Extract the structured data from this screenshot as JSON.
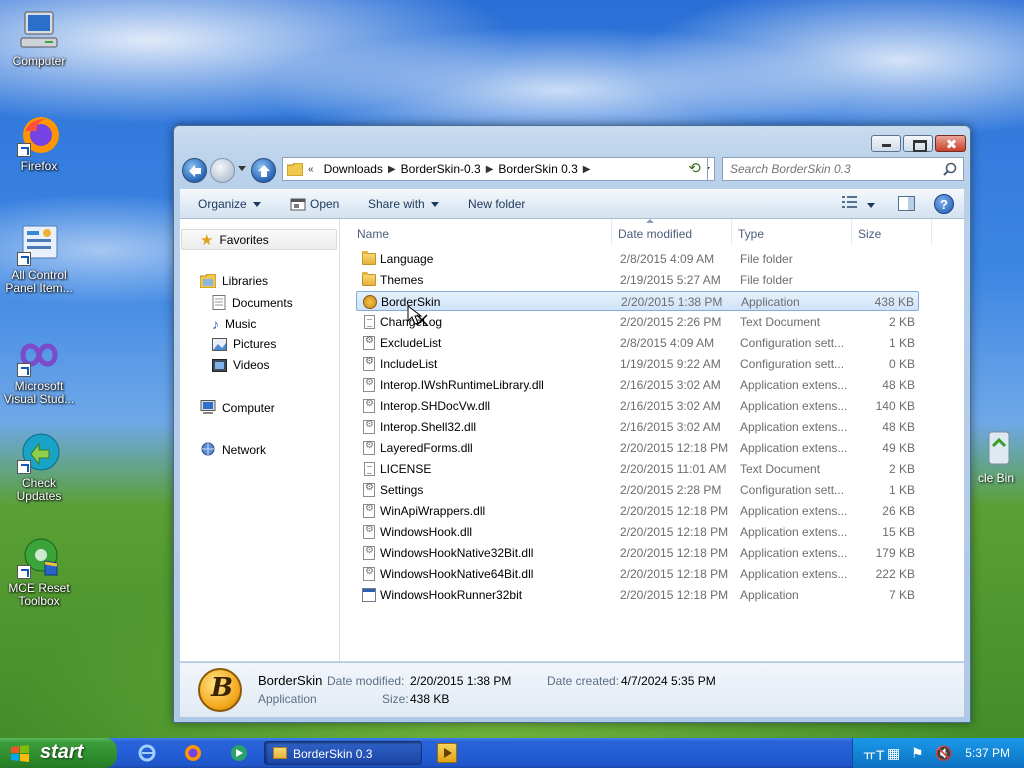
{
  "desktop": {
    "icons": [
      {
        "label": "Computer",
        "icon": "computer-icon"
      },
      {
        "label": "Firefox",
        "icon": "firefox-icon"
      },
      {
        "label": "All Control Panel Item...",
        "icon": "control-panel-icon"
      },
      {
        "label": "Microsoft Visual Stud...",
        "icon": "visual-studio-icon"
      },
      {
        "label": "Check Updates",
        "icon": "check-updates-icon"
      },
      {
        "label": "MCE Reset Toolbox",
        "icon": "mce-reset-icon"
      }
    ],
    "recycle_bin_label": "cle Bin"
  },
  "window": {
    "address": {
      "separator": "«",
      "crumbs": [
        "Downloads",
        "BorderSkin-0.3",
        "BorderSkin 0.3"
      ]
    },
    "search": {
      "placeholder": "Search BorderSkin 0.3"
    },
    "toolbar": {
      "organize": "Organize",
      "open": "Open",
      "share_with": "Share with",
      "new_folder": "New folder"
    },
    "nav": {
      "favorites": "Favorites",
      "libraries": "Libraries",
      "documents": "Documents",
      "music": "Music",
      "pictures": "Pictures",
      "videos": "Videos",
      "computer": "Computer",
      "network": "Network"
    },
    "columns": {
      "name": "Name",
      "date": "Date modified",
      "type": "Type",
      "size": "Size"
    },
    "files": [
      {
        "name": "Language",
        "date": "2/8/2015 4:09 AM",
        "type": "File folder",
        "size": "",
        "kind": "folder"
      },
      {
        "name": "Themes",
        "date": "2/19/2015 5:27 AM",
        "type": "File folder",
        "size": "",
        "kind": "folder"
      },
      {
        "name": "BorderSkin",
        "date": "2/20/2015 1:38 PM",
        "type": "Application",
        "size": "438 KB",
        "kind": "app",
        "selected": true
      },
      {
        "name": "ChangeLog",
        "date": "2/20/2015 2:26 PM",
        "type": "Text Document",
        "size": "2 KB",
        "kind": "doc"
      },
      {
        "name": "ExcludeList",
        "date": "2/8/2015 4:09 AM",
        "type": "Configuration sett...",
        "size": "1 KB",
        "kind": "cfg"
      },
      {
        "name": "IncludeList",
        "date": "1/19/2015 9:22 AM",
        "type": "Configuration sett...",
        "size": "0 KB",
        "kind": "cfg"
      },
      {
        "name": "Interop.IWshRuntimeLibrary.dll",
        "date": "2/16/2015 3:02 AM",
        "type": "Application extens...",
        "size": "48 KB",
        "kind": "dll"
      },
      {
        "name": "Interop.SHDocVw.dll",
        "date": "2/16/2015 3:02 AM",
        "type": "Application extens...",
        "size": "140 KB",
        "kind": "dll"
      },
      {
        "name": "Interop.Shell32.dll",
        "date": "2/16/2015 3:02 AM",
        "type": "Application extens...",
        "size": "48 KB",
        "kind": "dll"
      },
      {
        "name": "LayeredForms.dll",
        "date": "2/20/2015 12:18 PM",
        "type": "Application extens...",
        "size": "49 KB",
        "kind": "dll"
      },
      {
        "name": "LICENSE",
        "date": "2/20/2015 11:01 AM",
        "type": "Text Document",
        "size": "2 KB",
        "kind": "doc"
      },
      {
        "name": "Settings",
        "date": "2/20/2015 2:28 PM",
        "type": "Configuration sett...",
        "size": "1 KB",
        "kind": "cfg"
      },
      {
        "name": "WinApiWrappers.dll",
        "date": "2/20/2015 12:18 PM",
        "type": "Application extens...",
        "size": "26 KB",
        "kind": "dll"
      },
      {
        "name": "WindowsHook.dll",
        "date": "2/20/2015 12:18 PM",
        "type": "Application extens...",
        "size": "15 KB",
        "kind": "dll"
      },
      {
        "name": "WindowsHookNative32Bit.dll",
        "date": "2/20/2015 12:18 PM",
        "type": "Application extens...",
        "size": "179 KB",
        "kind": "dll"
      },
      {
        "name": "WindowsHookNative64Bit.dll",
        "date": "2/20/2015 12:18 PM",
        "type": "Application extens...",
        "size": "222 KB",
        "kind": "dll"
      },
      {
        "name": "WindowsHookRunner32bit",
        "date": "2/20/2015 12:18 PM",
        "type": "Application",
        "size": "7 KB",
        "kind": "exe"
      }
    ],
    "details": {
      "name": "BorderSkin",
      "type": "Application",
      "date_modified_label": "Date modified:",
      "date_modified": "2/20/2015 1:38 PM",
      "date_created_label": "Date created:",
      "date_created": "4/7/2024 5:35 PM",
      "size_label": "Size:",
      "size": "438 KB",
      "icon_letter": "B"
    }
  },
  "taskbar": {
    "start_label": "start",
    "active_task": "BorderSkin 0.3",
    "clock": "5:37 PM"
  },
  "colors": {
    "selection": "#cfe3f9",
    "taskbar_blue": "#245ed8",
    "start_green": "#3c9c3c"
  }
}
